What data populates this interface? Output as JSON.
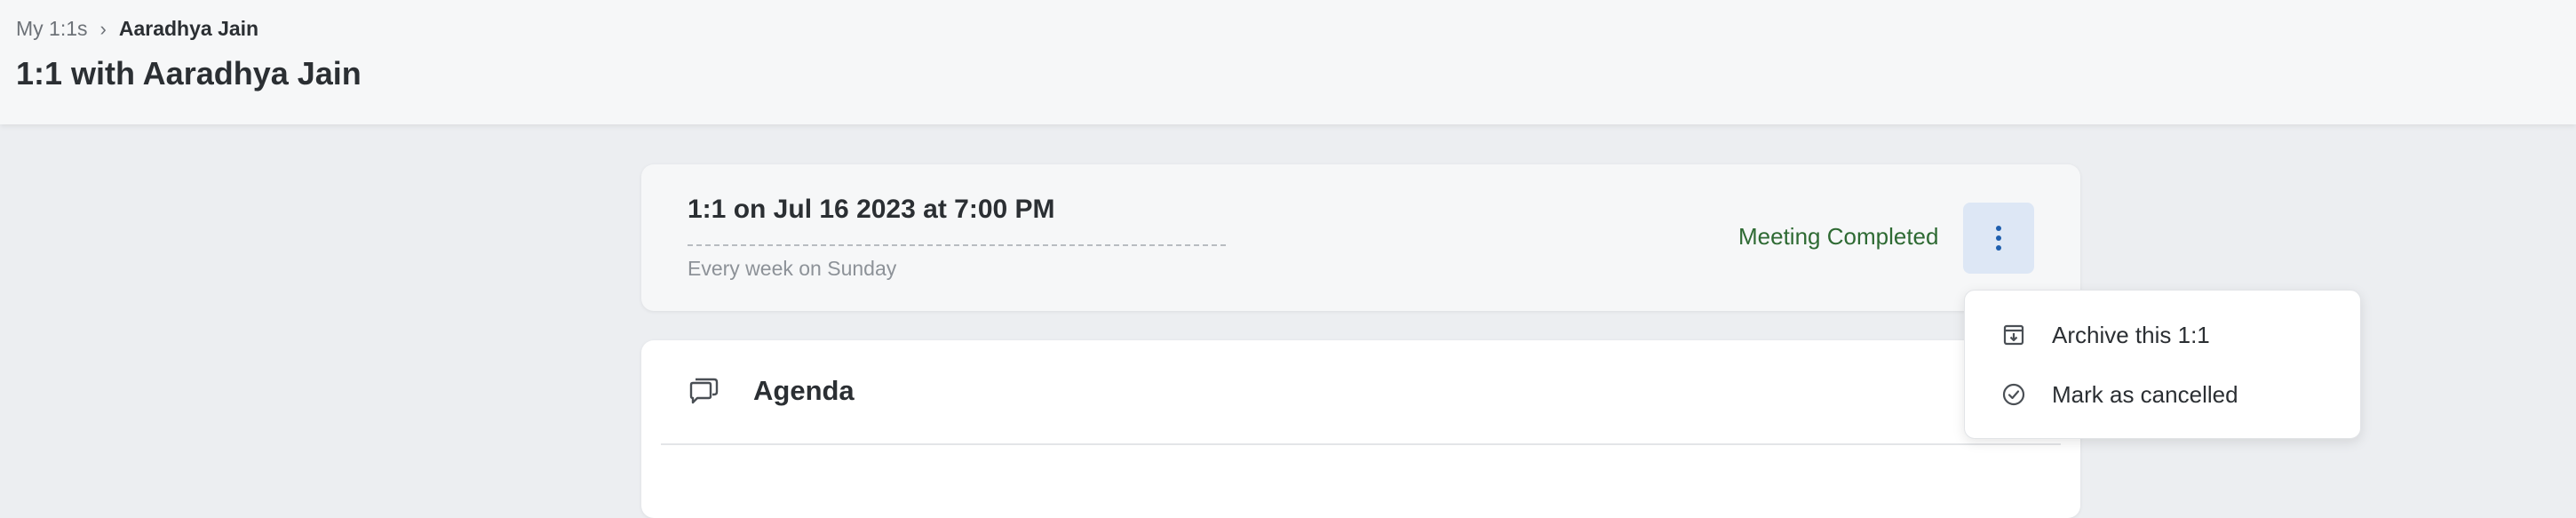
{
  "breadcrumb": {
    "parent": "My 1:1s",
    "separator": "›",
    "current": "Aaradhya Jain"
  },
  "page": {
    "title": "1:1 with Aaradhya Jain"
  },
  "meeting": {
    "title": "1:1 on Jul 16 2023 at 7:00 PM",
    "recurrence": "Every week on Sunday",
    "status": "Meeting Completed",
    "status_color": "#2e6a33",
    "more_icon": "kebab-vertical-icon"
  },
  "agenda": {
    "title": "Agenda",
    "icon": "chat-bubbles-icon"
  },
  "menu": {
    "items": [
      {
        "label": "Archive this 1:1",
        "icon": "archive-icon"
      },
      {
        "label": "Mark as cancelled",
        "icon": "check-circle-icon"
      }
    ]
  }
}
